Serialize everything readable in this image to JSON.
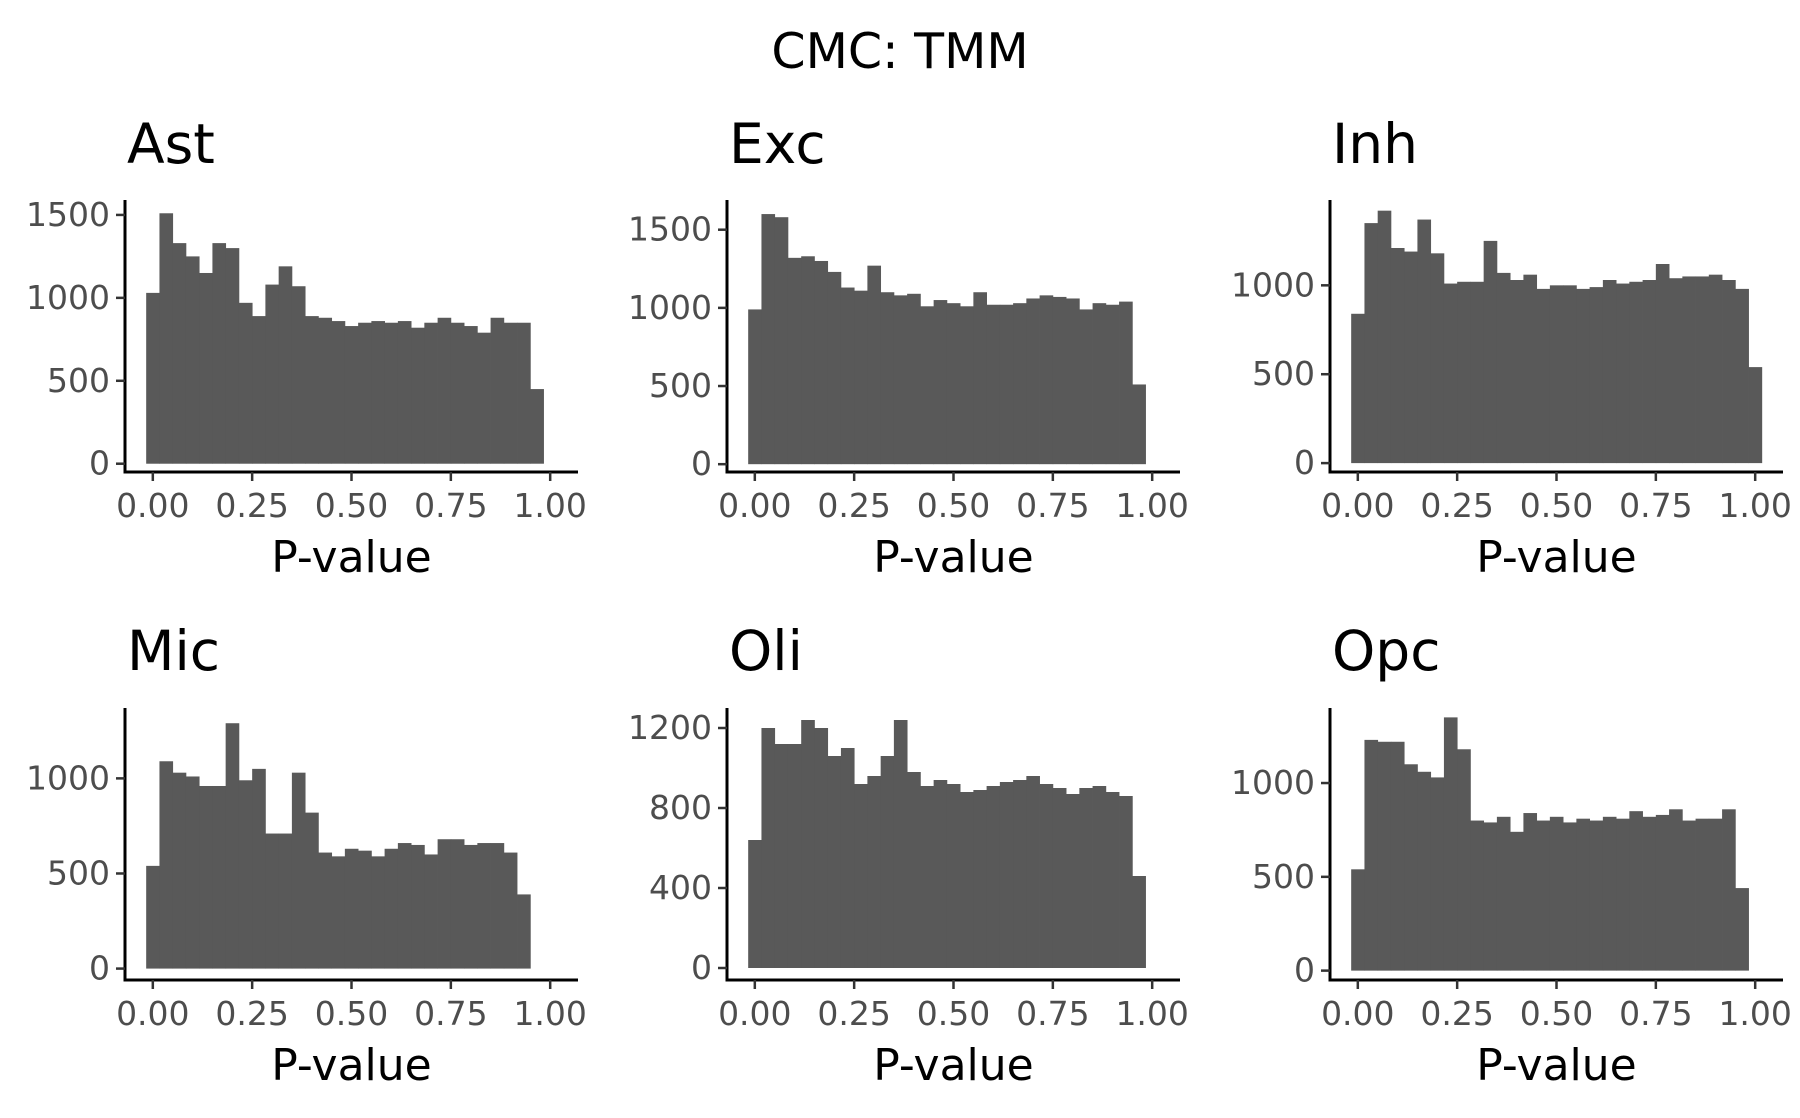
{
  "figure": {
    "title": "CMC: TMM"
  },
  "chart_data": [
    {
      "type": "bar",
      "title": "Ast",
      "xlabel": "P-value",
      "ylabel": "",
      "bin_width": 0.0333,
      "bin_starts": [
        -0.0167,
        0.0167,
        0.05,
        0.0833,
        0.1167,
        0.15,
        0.1833,
        0.2167,
        0.25,
        0.2833,
        0.3167,
        0.35,
        0.3833,
        0.4167,
        0.45,
        0.4833,
        0.5167,
        0.55,
        0.5833,
        0.6167,
        0.65,
        0.6833,
        0.7167,
        0.75,
        0.7833,
        0.8167,
        0.85,
        0.8833,
        0.9167,
        0.95,
        0.9833
      ],
      "values": [
        1030,
        1510,
        1330,
        1250,
        1150,
        1330,
        1300,
        970,
        890,
        1080,
        1190,
        1070,
        890,
        880,
        860,
        830,
        850,
        860,
        850,
        860,
        820,
        850,
        880,
        850,
        830,
        790,
        880,
        850,
        850,
        450,
        0
      ],
      "xlim": [
        -0.07,
        1.07
      ],
      "ylim": [
        -50,
        1590
      ],
      "x_ticks": [
        "0.00",
        "0.25",
        "0.50",
        "0.75",
        "1.00"
      ],
      "x_tick_values": [
        0,
        0.25,
        0.5,
        0.75,
        1
      ],
      "y_ticks": [
        "0",
        "500",
        "1000",
        "1500"
      ],
      "y_tick_values": [
        0,
        500,
        1000,
        1500
      ],
      "bar_color": "#595959"
    },
    {
      "type": "bar",
      "title": "Exc",
      "xlabel": "P-value",
      "ylabel": "",
      "bin_width": 0.0333,
      "bin_starts": [
        -0.0167,
        0.0167,
        0.05,
        0.0833,
        0.1167,
        0.15,
        0.1833,
        0.2167,
        0.25,
        0.2833,
        0.3167,
        0.35,
        0.3833,
        0.4167,
        0.45,
        0.4833,
        0.5167,
        0.55,
        0.5833,
        0.6167,
        0.65,
        0.6833,
        0.7167,
        0.75,
        0.7833,
        0.8167,
        0.85,
        0.8833,
        0.9167,
        0.95,
        0.9833
      ],
      "values": [
        990,
        1600,
        1580,
        1320,
        1330,
        1300,
        1230,
        1130,
        1110,
        1270,
        1100,
        1080,
        1090,
        1010,
        1050,
        1030,
        1010,
        1100,
        1020,
        1020,
        1030,
        1060,
        1080,
        1070,
        1060,
        990,
        1030,
        1020,
        1040,
        510,
        0
      ],
      "xlim": [
        -0.07,
        1.07
      ],
      "ylim": [
        -50,
        1690
      ],
      "x_ticks": [
        "0.00",
        "0.25",
        "0.50",
        "0.75",
        "1.00"
      ],
      "x_tick_values": [
        0,
        0.25,
        0.5,
        0.75,
        1
      ],
      "y_ticks": [
        "0",
        "500",
        "1000",
        "1500"
      ],
      "y_tick_values": [
        0,
        500,
        1000,
        1500
      ],
      "bar_color": "#595959"
    },
    {
      "type": "bar",
      "title": "Inh",
      "xlabel": "P-value",
      "ylabel": "",
      "bin_width": 0.0333,
      "bin_starts": [
        -0.0167,
        0.0167,
        0.05,
        0.0833,
        0.1167,
        0.15,
        0.1833,
        0.2167,
        0.25,
        0.2833,
        0.3167,
        0.35,
        0.3833,
        0.4167,
        0.45,
        0.4833,
        0.5167,
        0.55,
        0.5833,
        0.6167,
        0.65,
        0.6833,
        0.7167,
        0.75,
        0.7833,
        0.8167,
        0.85,
        0.8833,
        0.9167,
        0.95,
        0.9833
      ],
      "values": [
        840,
        1350,
        1420,
        1210,
        1190,
        1370,
        1180,
        1010,
        1020,
        1020,
        1250,
        1070,
        1030,
        1060,
        980,
        1000,
        1000,
        980,
        990,
        1030,
        1010,
        1020,
        1030,
        1120,
        1040,
        1050,
        1050,
        1060,
        1030,
        980,
        540
      ],
      "xlim": [
        -0.07,
        1.07
      ],
      "ylim": [
        -50,
        1480
      ],
      "x_ticks": [
        "0.00",
        "0.25",
        "0.50",
        "0.75",
        "1.00"
      ],
      "x_tick_values": [
        0,
        0.25,
        0.5,
        0.75,
        1
      ],
      "y_ticks": [
        "0",
        "500",
        "1000"
      ],
      "y_tick_values": [
        0,
        500,
        1000
      ],
      "bar_color": "#595959"
    },
    {
      "type": "bar",
      "title": "Mic",
      "xlabel": "P-value",
      "ylabel": "",
      "bin_width": 0.0333,
      "bin_starts": [
        -0.0167,
        0.0167,
        0.05,
        0.0833,
        0.1167,
        0.15,
        0.1833,
        0.2167,
        0.25,
        0.2833,
        0.3167,
        0.35,
        0.3833,
        0.4167,
        0.45,
        0.4833,
        0.5167,
        0.55,
        0.5833,
        0.6167,
        0.65,
        0.6833,
        0.7167,
        0.75,
        0.7833,
        0.8167,
        0.85,
        0.8833,
        0.9167,
        0.95,
        0.9833
      ],
      "values": [
        540,
        1090,
        1030,
        1010,
        960,
        960,
        1290,
        990,
        1050,
        710,
        710,
        1030,
        820,
        610,
        590,
        630,
        620,
        590,
        630,
        660,
        650,
        600,
        680,
        680,
        650,
        660,
        660,
        610,
        390,
        0,
        0
      ],
      "xlim": [
        -0.07,
        1.07
      ],
      "ylim": [
        -60,
        1370
      ],
      "x_ticks": [
        "0.00",
        "0.25",
        "0.50",
        "0.75",
        "1.00"
      ],
      "x_tick_values": [
        0,
        0.25,
        0.5,
        0.75,
        1
      ],
      "y_ticks": [
        "0",
        "500",
        "1000"
      ],
      "y_tick_values": [
        0,
        500,
        1000
      ],
      "bar_color": "#595959"
    },
    {
      "type": "bar",
      "title": "Oli",
      "xlabel": "P-value",
      "ylabel": "",
      "bin_width": 0.0333,
      "bin_starts": [
        -0.0167,
        0.0167,
        0.05,
        0.0833,
        0.1167,
        0.15,
        0.1833,
        0.2167,
        0.25,
        0.2833,
        0.3167,
        0.35,
        0.3833,
        0.4167,
        0.45,
        0.4833,
        0.5167,
        0.55,
        0.5833,
        0.6167,
        0.65,
        0.6833,
        0.7167,
        0.75,
        0.7833,
        0.8167,
        0.85,
        0.8833,
        0.9167,
        0.95,
        0.9833
      ],
      "values": [
        640,
        1200,
        1120,
        1120,
        1240,
        1200,
        1060,
        1100,
        920,
        960,
        1060,
        1240,
        980,
        910,
        940,
        920,
        880,
        890,
        910,
        930,
        940,
        960,
        920,
        900,
        870,
        900,
        910,
        880,
        860,
        460,
        0
      ],
      "xlim": [
        -0.07,
        1.07
      ],
      "ylim": [
        -60,
        1300
      ],
      "x_ticks": [
        "0.00",
        "0.25",
        "0.50",
        "0.75",
        "1.00"
      ],
      "x_tick_values": [
        0,
        0.25,
        0.5,
        0.75,
        1
      ],
      "y_ticks": [
        "0",
        "400",
        "800",
        "1200"
      ],
      "y_tick_values": [
        0,
        400,
        800,
        1200
      ],
      "bar_color": "#595959"
    },
    {
      "type": "bar",
      "title": "Opc",
      "xlabel": "P-value",
      "ylabel": "",
      "bin_width": 0.0333,
      "bin_starts": [
        -0.0167,
        0.0167,
        0.05,
        0.0833,
        0.1167,
        0.15,
        0.1833,
        0.2167,
        0.25,
        0.2833,
        0.3167,
        0.35,
        0.3833,
        0.4167,
        0.45,
        0.4833,
        0.5167,
        0.55,
        0.5833,
        0.6167,
        0.65,
        0.6833,
        0.7167,
        0.75,
        0.7833,
        0.8167,
        0.85,
        0.8833,
        0.9167,
        0.95,
        0.9833
      ],
      "values": [
        540,
        1230,
        1220,
        1220,
        1100,
        1060,
        1030,
        1350,
        1180,
        800,
        790,
        820,
        740,
        840,
        800,
        820,
        790,
        810,
        800,
        820,
        810,
        850,
        820,
        830,
        860,
        800,
        810,
        810,
        860,
        440,
        0
      ],
      "xlim": [
        -0.07,
        1.07
      ],
      "ylim": [
        -50,
        1400
      ],
      "x_ticks": [
        "0.00",
        "0.25",
        "0.50",
        "0.75",
        "1.00"
      ],
      "x_tick_values": [
        0,
        0.25,
        0.5,
        0.75,
        1
      ],
      "y_ticks": [
        "0",
        "500",
        "1000"
      ],
      "y_tick_values": [
        0,
        500,
        1000
      ],
      "bar_color": "#595959"
    }
  ]
}
